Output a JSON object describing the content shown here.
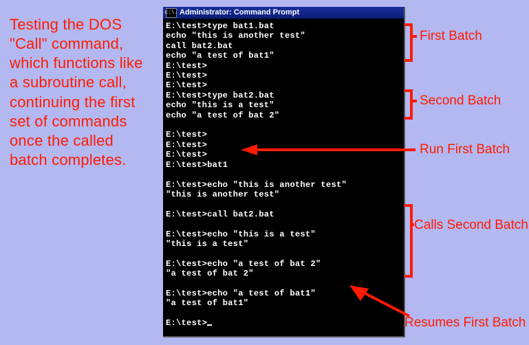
{
  "caption": "Testing the DOS \"Call\" command, which functions like a subroutine call, continuing the first set of commands once the called batch completes.",
  "window": {
    "title": "Administrator: Command Prompt",
    "icon_glyph": "c:\\.",
    "icon_name": "cmd-icon"
  },
  "terminal": {
    "lines": [
      "E:\\test>type bat1.bat",
      "echo \"this is another test\"",
      "call bat2.bat",
      "echo \"a test of bat1\"",
      "E:\\test>",
      "E:\\test>",
      "E:\\test>",
      "E:\\test>type bat2.bat",
      "echo \"this is a test\"",
      "echo \"a test of bat 2\"",
      "",
      "E:\\test>",
      "E:\\test>",
      "E:\\test>",
      "E:\\test>bat1",
      "",
      "E:\\test>echo \"this is another test\"",
      "\"this is another test\"",
      "",
      "E:\\test>call bat2.bat",
      "",
      "E:\\test>echo \"this is a test\"",
      "\"this is a test\"",
      "",
      "E:\\test>echo \"a test of bat 2\"",
      "\"a test of bat 2\"",
      "",
      "E:\\test>echo \"a test of bat1\"",
      "\"a test of bat1\"",
      "",
      "E:\\test>"
    ],
    "show_cursor_on_last": true
  },
  "annotations": {
    "first_batch": "First Batch",
    "second_batch": "Second Batch",
    "run_first": "Run First Batch",
    "calls_second": "Calls Second Batch",
    "resumes_first": "Resumes First Batch"
  },
  "colors": {
    "bg": "#b4b8f0",
    "accent": "#ff1a00",
    "titlebar": "#1a2f9a",
    "term_bg": "#000000",
    "term_fg": "#ffffff"
  }
}
